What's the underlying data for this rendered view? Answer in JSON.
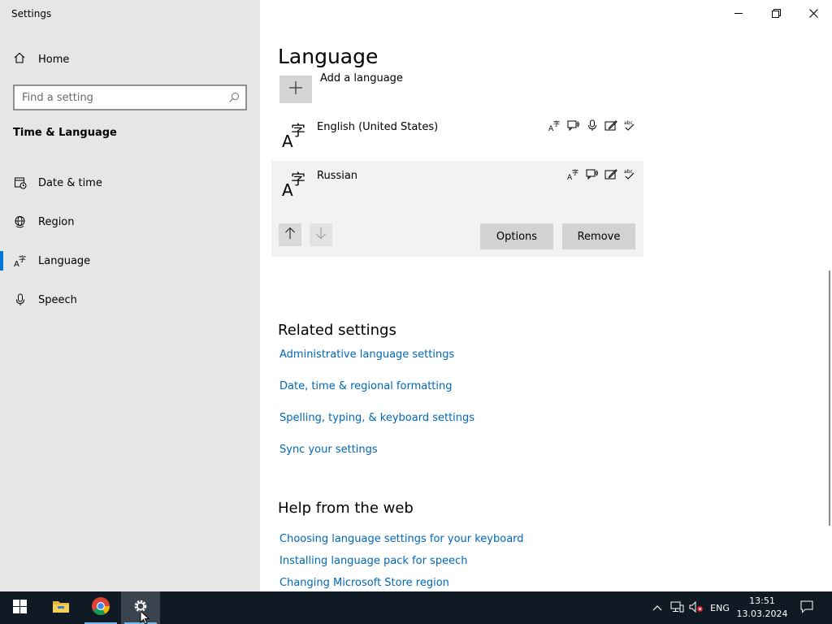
{
  "window": {
    "title": "Settings"
  },
  "sidebar": {
    "home_label": "Home",
    "search_placeholder": "Find a setting",
    "section_title": "Time & Language",
    "items": [
      {
        "label": "Date & time",
        "icon": "date-time-icon"
      },
      {
        "label": "Region",
        "icon": "region-globe-icon"
      },
      {
        "label": "Language",
        "icon": "language-icon",
        "selected": true
      },
      {
        "label": "Speech",
        "icon": "microphone-icon"
      }
    ]
  },
  "main": {
    "title": "Language",
    "add_language_label": "Add a language",
    "languages": [
      {
        "name": "English (United States)",
        "selected": false
      },
      {
        "name": "Russian",
        "selected": true
      }
    ],
    "feature_icons": [
      "display-language-icon",
      "text-to-speech-icon",
      "speech-recognition-icon",
      "handwriting-icon",
      "spell-check-icon"
    ],
    "options_label": "Options",
    "remove_label": "Remove",
    "related_title": "Related settings",
    "related_links": [
      "Administrative language settings",
      "Date, time & regional formatting",
      "Spelling, typing, & keyboard settings",
      "Sync your settings"
    ],
    "help_title": "Help from the web",
    "help_links": [
      "Choosing language settings for your keyboard",
      "Installing language pack for speech",
      "Changing Microsoft Store region"
    ]
  },
  "taskbar": {
    "apps": [
      "start-icon",
      "file-explorer-icon",
      "chrome-icon",
      "settings-gear-icon"
    ],
    "active_app": "settings-gear-icon",
    "input_language": "ENG",
    "time": "13:51",
    "date": "13.03.2024"
  },
  "colors": {
    "accent": "#0078d7",
    "link": "#0067b8",
    "sidebar_bg": "#e6e6e6",
    "taskbar_bg": "#101a24"
  }
}
